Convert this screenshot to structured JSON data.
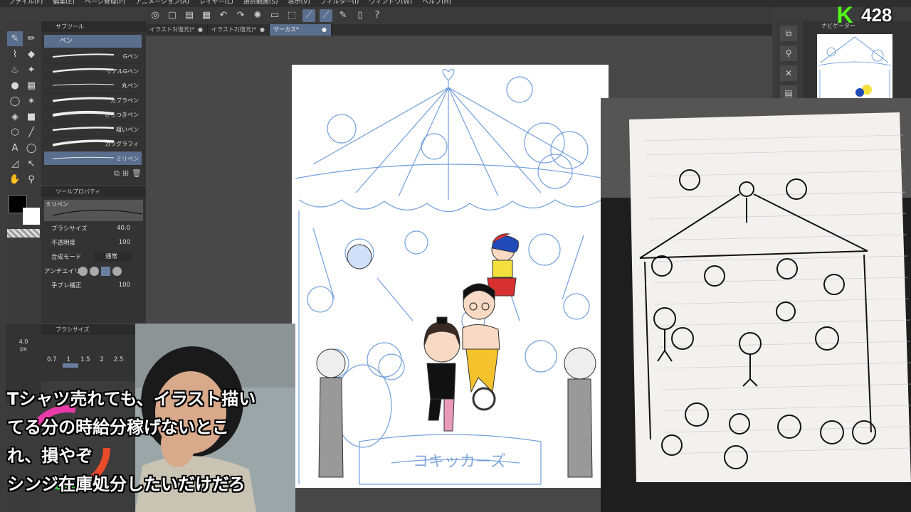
{
  "menubar": {
    "items": [
      "ファイル(F)",
      "編集(E)",
      "ページ管理(P)",
      "アニメーション(A)",
      "レイヤー(L)",
      "選択範囲(S)",
      "表示(V)",
      "フィルター(I)",
      "ウィンドウ(W)",
      "ヘルプ(H)"
    ]
  },
  "subtool": {
    "panel_title": "サブツール",
    "group_label": "ペン",
    "brushes": [
      {
        "label": "Gペン"
      },
      {
        "label": "リアルGペン"
      },
      {
        "label": "丸ペン"
      },
      {
        "label": "カブラペン"
      },
      {
        "label": "さらつきペン"
      },
      {
        "label": "粗いペン"
      },
      {
        "label": "カリグラフィ"
      },
      {
        "label": "ミリペン"
      }
    ]
  },
  "toolprop": {
    "panel_title": "ツールプロパティ",
    "preview_label": "ミリペン",
    "brush_size_label": "ブラシサイズ",
    "brush_size_value": "40.0",
    "opacity_label": "不透明度",
    "opacity_value": "100",
    "blend_label": "合成モード",
    "blend_value": "通常",
    "aa_label": "アンチエイリ",
    "stabilizer_label": "手ブレ補正",
    "stabilizer_value": "100"
  },
  "brushsize_panel": {
    "title": "ブラシサイズ",
    "sizes": [
      "0.7",
      "1",
      "1.5",
      "2",
      "2.5"
    ],
    "selected": "1"
  },
  "minislider": {
    "value": "4.0",
    "unit": "px"
  },
  "doctabs": [
    {
      "label": "イラスト3(復元)*",
      "active": false
    },
    {
      "label": "イラスト2(復元)*",
      "active": false
    },
    {
      "label": "サーカス*",
      "active": true
    }
  ],
  "navigator": {
    "title": "ナビゲーター"
  },
  "badge": {
    "logo": "K",
    "count": "428"
  },
  "captions": [
    "Tシャツ売れても、イラスト描い",
    "てる分の時給分稼げないとこ",
    "れ、損やぞ",
    "シンジ在庫処分したいだけだろ"
  ],
  "colors": {
    "accent": "#5a6e8d",
    "sketch_blue": "#5b8fd6",
    "kick_green": "#53fc18"
  }
}
